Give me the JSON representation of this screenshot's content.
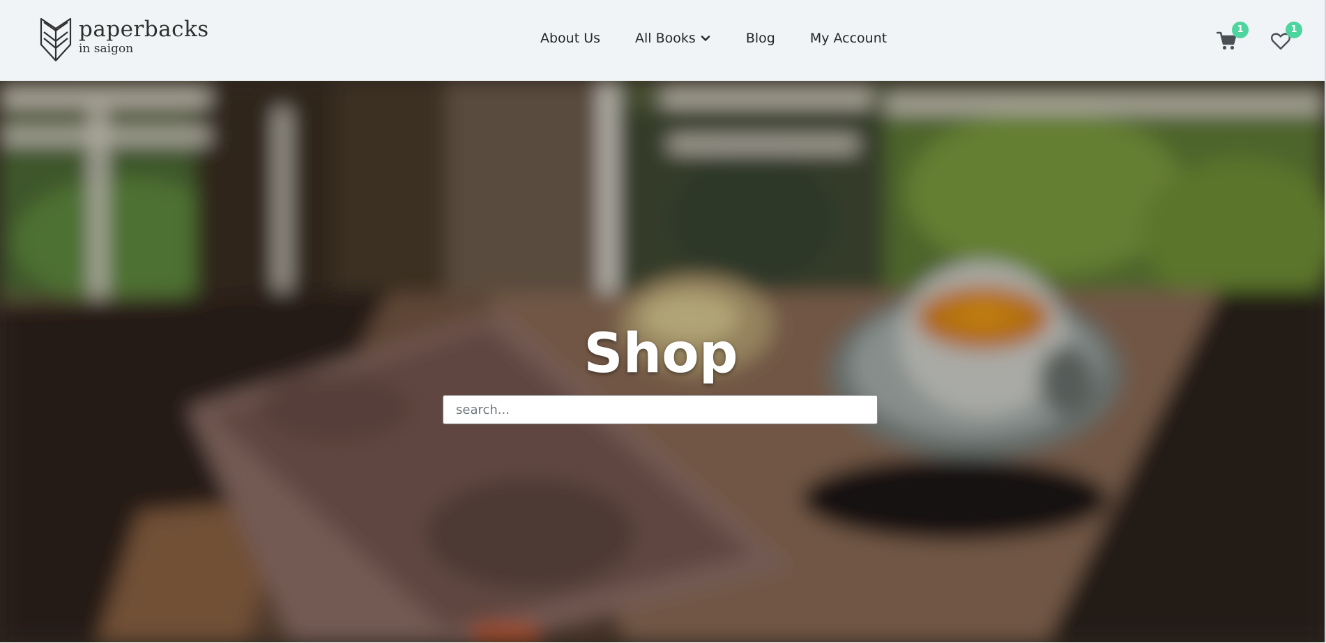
{
  "header": {
    "logo": {
      "title": "paperbacks",
      "subtitle": "in saigon"
    },
    "nav": [
      {
        "label": "About Us"
      },
      {
        "label": "All Books",
        "has_dropdown": true
      },
      {
        "label": "Blog"
      },
      {
        "label": "My Account"
      }
    ],
    "cart": {
      "icon": "cart-icon",
      "count": "1"
    },
    "wishlist": {
      "icon": "heart-icon",
      "count": "1"
    }
  },
  "hero": {
    "title": "Shop",
    "search_placeholder": "search..."
  },
  "colors": {
    "header_bg": "#f0f4f6",
    "badge": "#4ed59f",
    "nav_text": "#23272b"
  }
}
